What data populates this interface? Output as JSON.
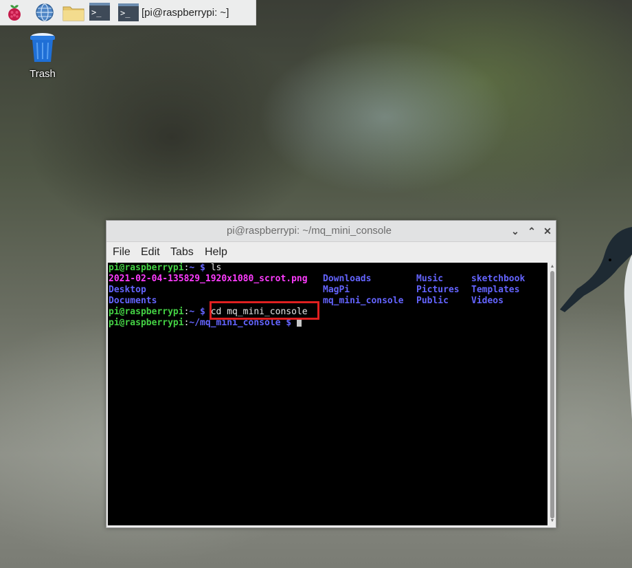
{
  "taskbar": {
    "icons": [
      "raspberry-icon",
      "web-browser-icon",
      "file-manager-icon",
      "terminal-icon"
    ],
    "task_label": "[pi@raspberrypi: ~]"
  },
  "desktop": {
    "trash_label": "Trash"
  },
  "window": {
    "title": "pi@raspberrypi: ~/mq_mini_console",
    "menu": [
      "File",
      "Edit",
      "Tabs",
      "Help"
    ],
    "colors": {
      "prompt_user": "#44d244",
      "prompt_path": "#6464ff",
      "directory": "#6464ff",
      "image_file": "#ff3cff",
      "highlight_box": "#e02020"
    }
  },
  "terminal": {
    "line1": {
      "user": "pi@raspberrypi",
      "sep": ":",
      "path": "~",
      "dollar": " $ ",
      "command": "ls"
    },
    "listing": {
      "col1": [
        "2021-02-04-135829_1920x1080_scrot.png",
        "Desktop",
        "Documents"
      ],
      "col2": [
        "Downloads",
        "MagPi",
        "mq_mini_console"
      ],
      "col3": [
        "Music",
        "Pictures",
        "Public"
      ],
      "col4": [
        "sketchbook",
        "Templates",
        "Videos"
      ]
    },
    "line5": {
      "user": "pi@raspberrypi",
      "sep": ":",
      "path": "~",
      "dollar": " $ ",
      "command": "cd mq_mini_console"
    },
    "line6": {
      "user": "pi@raspberrypi",
      "sep": ":",
      "path": "~/mq_mini_console",
      "dollar": " $ "
    }
  }
}
